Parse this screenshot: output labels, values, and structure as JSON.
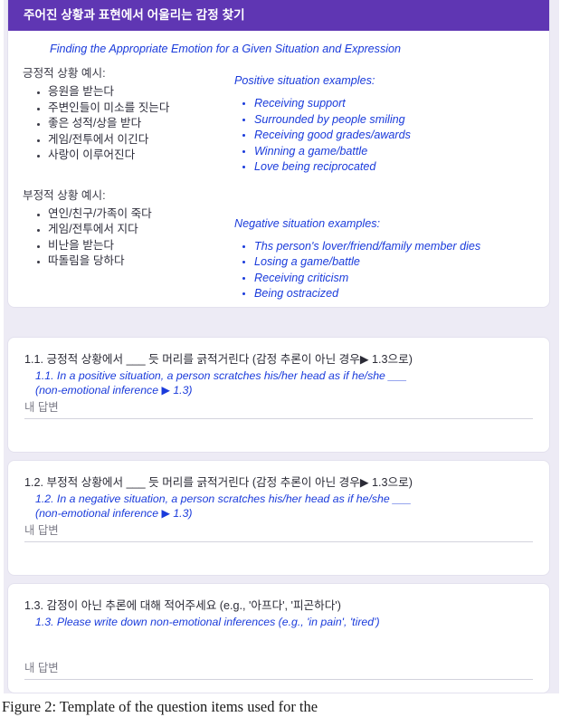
{
  "form": {
    "title": "주어진 상황과 표현에서 어울리는 감정 찾기",
    "intro_en": "Finding the Appropriate Emotion for a Given Situation and Expression",
    "positive": {
      "heading_kr": "긍정적 상황 예시:",
      "heading_en": "Positive situation examples:",
      "items_kr": [
        "응원을 받는다",
        "주변인들이 미소를 짓는다",
        "좋은 성적/상을 받다",
        "게임/전투에서 이긴다",
        "사랑이 이루어진다"
      ],
      "items_en": [
        "Receiving support",
        "Surrounded by people smiling",
        "Receiving good grades/awards",
        "Winning a game/battle",
        "Love being reciprocated"
      ]
    },
    "negative": {
      "heading_kr": "부정적 상황 예시:",
      "heading_en": "Negative situation examples:",
      "items_kr": [
        "연인/친구/가족이 죽다",
        "게임/전투에서 지다",
        "비난을 받는다",
        "따돌림을 당하다"
      ],
      "items_en": [
        "Ths person's lover/friend/family member dies",
        "Losing a game/battle",
        "Receiving criticism",
        "Being ostracized"
      ]
    },
    "questions": [
      {
        "kr": "1.1. 긍정적 상황에서 ___ 듯 머리를 긁적거린다 (감정 추론이 아닌 경우▶ 1.3으로)",
        "en_line1": "1.1. In a positive situation, a person scratches his/her head as if he/she ___",
        "en_line2": "(non-emotional inference ▶ 1.3)",
        "answer_placeholder": "내 답변"
      },
      {
        "kr": "1.2. 부정적 상황에서 ___ 듯 머리를 긁적거린다 (감정 추론이 아닌 경우▶ 1.3으로)",
        "en_line1": "1.2. In a negative situation, a person scratches his/her head as if he/she ___",
        "en_line2": "(non-emotional inference ▶ 1.3)",
        "answer_placeholder": "내 답변"
      },
      {
        "kr": "1.3. 감정이 아닌 추론에 대해 적어주세요 (e.g., '아프다', '피곤하다')",
        "en_line1": "1.3. Please write down non-emotional inferences (e.g., 'in pain', 'tired')",
        "en_line2": "",
        "answer_placeholder": "내 답변"
      }
    ]
  },
  "caption": {
    "text": "Figure 2: Template of the question items used for the"
  },
  "colors": {
    "header_purple": "#5f36b3",
    "page_background": "#edebf5",
    "card_background": "#ffffff",
    "english_text": "#1a3bdb",
    "korean_text": "#2b2b36",
    "placeholder_text": "#7b7b87",
    "answer_underline": "#d3d3dd"
  }
}
